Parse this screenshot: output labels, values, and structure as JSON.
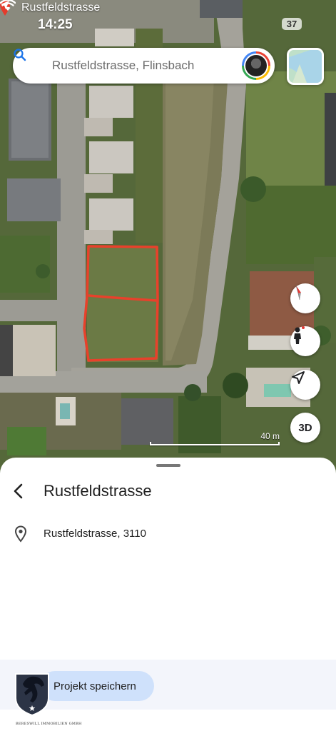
{
  "status_bar": {
    "back_app_label": "Rustfeldstrasse",
    "time": "14:25",
    "battery": "37"
  },
  "search": {
    "query": "Rustfeldstrasse, Flinsbach"
  },
  "map": {
    "scale_label": "40 m",
    "three_d_label": "3D",
    "highlight_color": "#e8412b"
  },
  "place": {
    "title": "Rustfeldstrasse",
    "address": "Rustfeldstrasse, 3110"
  },
  "footer": {
    "save_project_label": "Projekt speichern",
    "brand_text": "BERESWILL IMMOBILIEN GMBH"
  },
  "icons": [
    "search-icon",
    "location-arrow-icon",
    "wifi-icon",
    "compass-icon",
    "pegman-icon",
    "my-location-icon",
    "back-arrow-icon",
    "location-pin-icon",
    "horse-logo-icon"
  ]
}
